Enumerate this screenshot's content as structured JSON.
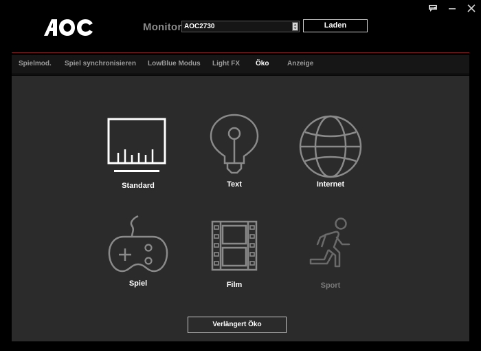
{
  "header": {
    "brand": "AOC",
    "monitor_label": "Monitor",
    "monitor_selected": "AOC2730",
    "load_button": "Laden"
  },
  "tabs": [
    {
      "label": "Spielmod."
    },
    {
      "label": "Spiel synchronisieren"
    },
    {
      "label": "LowBlue Modus"
    },
    {
      "label": "Light FX"
    },
    {
      "label": "Öko"
    },
    {
      "label": "Anzeige"
    }
  ],
  "active_tab": "Öko",
  "modes": [
    {
      "label": "Standard",
      "icon": "standard-icon",
      "selected": true
    },
    {
      "label": "Text",
      "icon": "lightbulb-icon"
    },
    {
      "label": "Internet",
      "icon": "globe-icon"
    },
    {
      "label": "Spiel",
      "icon": "gamepad-icon"
    },
    {
      "label": "Film",
      "icon": "film-icon"
    },
    {
      "label": "Sport",
      "icon": "runner-icon",
      "dimmed": true
    }
  ],
  "eco_button": "Verlängert Öko",
  "colors": {
    "background": "#000000",
    "panel": "#2b2b2b",
    "accent_red": "#7a1a1a",
    "icon_active": "#ffffff",
    "icon_inactive": "#8a8a8a"
  }
}
